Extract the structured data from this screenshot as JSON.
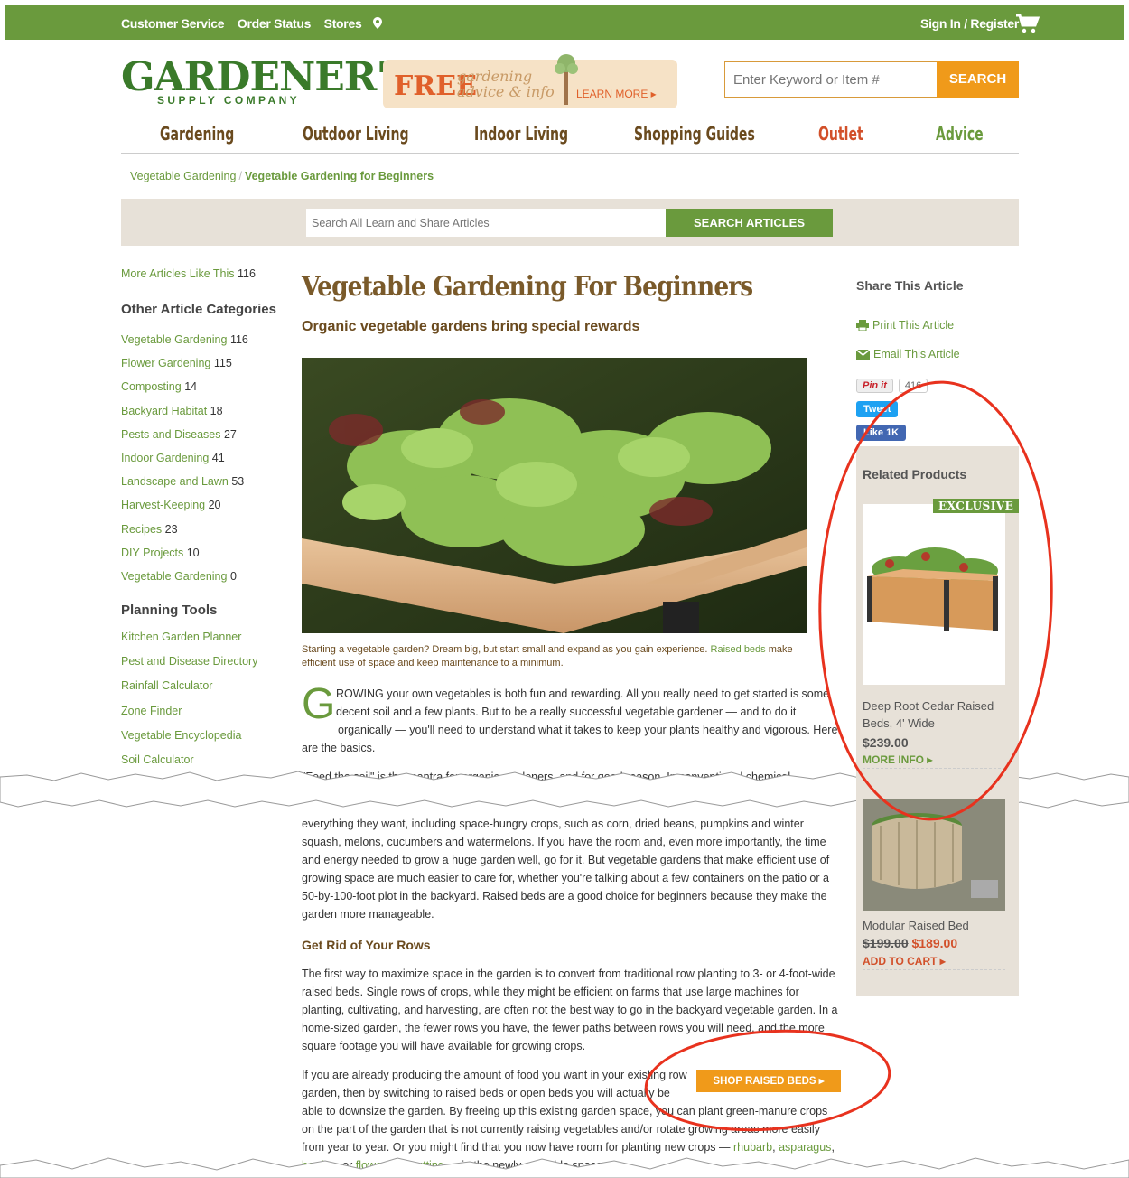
{
  "topbar": {
    "customer_service": "Customer Service",
    "order_status": "Order Status",
    "stores": "Stores",
    "sign_in": "Sign In / Register",
    "cart_icon": "cart-icon"
  },
  "header": {
    "logo_main": "GARDENER'S",
    "logo_sub": "SUPPLY COMPANY",
    "promo_free": "FREE",
    "promo_line1": "gardening",
    "promo_line2": "advice & info",
    "promo_learn": "LEARN MORE ▸",
    "search_placeholder": "Enter Keyword or Item #",
    "search_button": "SEARCH"
  },
  "nav": {
    "items": [
      "Gardening",
      "Outdoor Living",
      "Indoor Living",
      "Shopping Guides",
      "Outlet",
      "Advice"
    ]
  },
  "breadcrumb": {
    "parent": "Vegetable Gardening",
    "separator": "/",
    "current": "Vegetable Gardening for Beginners"
  },
  "article_search": {
    "placeholder": "Search All Learn and Share Articles",
    "button": "SEARCH ARTICLES"
  },
  "sidebar": {
    "more_label": "More Articles Like This",
    "more_count": "116",
    "categories_heading": "Other Article Categories",
    "categories": [
      {
        "label": "Vegetable Gardening",
        "count": "116"
      },
      {
        "label": "Flower Gardening",
        "count": "115"
      },
      {
        "label": "Composting",
        "count": "14"
      },
      {
        "label": "Backyard Habitat",
        "count": "18"
      },
      {
        "label": "Pests and Diseases",
        "count": "27"
      },
      {
        "label": "Indoor Gardening",
        "count": "41"
      },
      {
        "label": "Landscape and Lawn",
        "count": "53"
      },
      {
        "label": "Harvest-Keeping",
        "count": "20"
      },
      {
        "label": "Recipes",
        "count": "23"
      },
      {
        "label": "DIY Projects",
        "count": "10"
      },
      {
        "label": "Vegetable Gardening",
        "count": "0"
      }
    ],
    "tools_heading": "Planning Tools",
    "tools": [
      "Kitchen Garden Planner",
      "Pest and Disease Directory",
      "Rainfall Calculator",
      "Zone Finder",
      "Vegetable Encyclopedia",
      "Soil Calculator"
    ]
  },
  "article": {
    "title": "Vegetable Gardening For Beginners",
    "subtitle": "Organic vegetable gardens bring special rewards",
    "caption_a": "Starting a vegetable garden? Dream big, but start small and expand as you gain experience.",
    "caption_link": "Raised beds",
    "caption_b": "make efficient use of space and keep maintenance to a minimum.",
    "dropcap": "G",
    "intro_l1": "ROWING your own vegetables is both fun and rewarding. All you really need to get started is some",
    "intro_l2": "decent soil and a few plants. But to be a really successful vegetable gardener — and to do it",
    "intro_l3": "organically — you'll need to understand what it takes to keep your plants healthy and vigorous. Here",
    "intro_l4": "are the basics.",
    "cut_line": "\"Feed the soil\" is the mantra for organic gardeners, and for good reason. In conventional chemical",
    "para2": "everything they want, including space-hungry crops, such as corn, dried beans, pumpkins and winter squash, melons, cucumbers and watermelons. If you have the room and, even more importantly, the time and energy needed to grow a huge garden well, go for it. But vegetable gardens that make efficient use of growing space are much easier to care for, whether you're talking about a few containers on the patio or a 50-by-100-foot plot in the backyard. Raised beds are a good choice for beginners because they make the garden more manageable.",
    "section_heading": "Get Rid of Your Rows",
    "para3": "The first way to maximize space in the garden is to convert from traditional row planting to 3- or 4-foot-wide raised beds. Single rows of crops, while they might be efficient on farms that use large machines for planting, cultivating, and harvesting, are often not the best way to go in the backyard vegetable garden. In a home-sized garden, the fewer rows you have, the fewer paths between rows you will need, and the more square footage you will have available for growing crops.",
    "para4_l1": "If you are already producing the amount of food you want in your existing row",
    "para4_l2": "garden, then by switching to raised beds or open beds you will actually be",
    "para4_rest": "able to downsize the garden. By freeing up this existing garden space, you can plant green-manure crops on the part of the garden that is not currently raising vegetables and/or rotate growing areas more easily from year to year. Or you might find that you now have room for planting new crops —",
    "link_rhubarb": "rhubarb",
    "link_asparagus": "asparagus",
    "link_berries": "berries",
    "text_or": ", or",
    "link_flowers": "flowers for cutting",
    "text_end": "— in the newly available space.",
    "shop_button": "SHOP RAISED BEDS ▸"
  },
  "share": {
    "heading": "Share This Article",
    "print": "Print This Article",
    "email": "Email This Article",
    "pin": "Pin it",
    "pin_count": "416",
    "tweet": "Tweet",
    "like": "Like 1K"
  },
  "related": {
    "heading": "Related Products",
    "badge": "EXCLUSIVE",
    "p1_name": "Deep Root Cedar Raised Beds, 4' Wide",
    "p1_price": "$239.00",
    "p1_action": "MORE INFO ▸",
    "p2_name": "Modular Raised Bed",
    "p2_old": "$199.00",
    "p2_price": "$189.00",
    "p2_action": "ADD TO CART ▸"
  },
  "colors": {
    "brand_green": "#6a9a3d",
    "brand_orange": "#f09a1a",
    "brown": "#6a4a1e",
    "annotation_red": "#e8321e"
  }
}
